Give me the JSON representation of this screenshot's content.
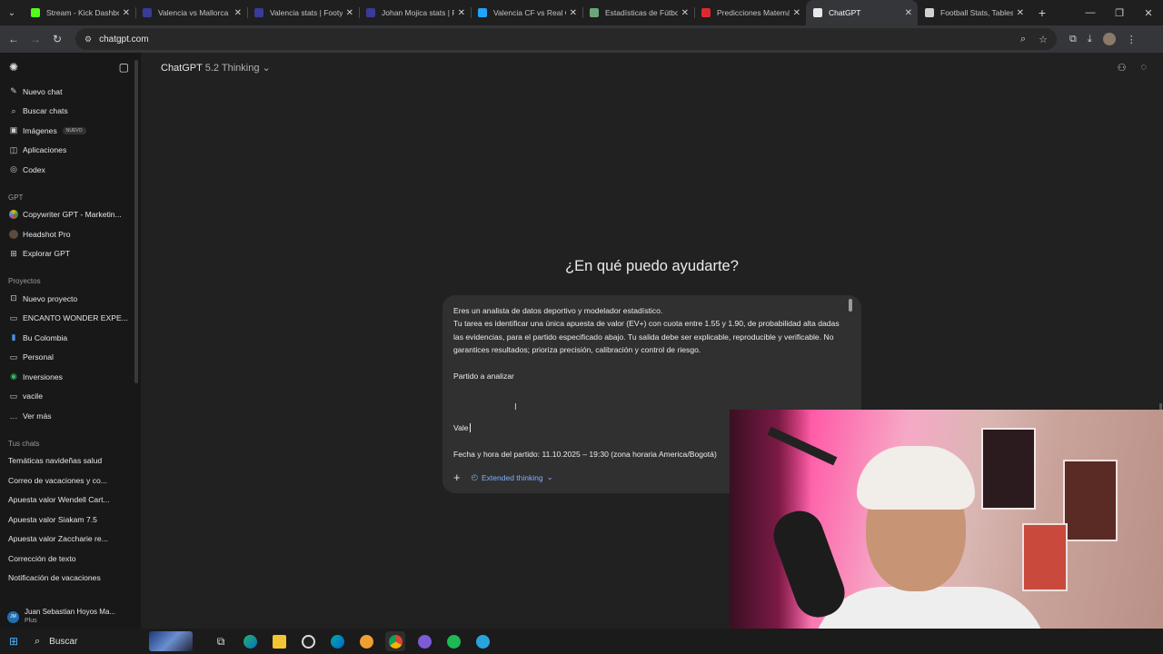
{
  "browser": {
    "tabs": [
      {
        "title": "Stream - Kick Dashbo",
        "color": "#53fc18"
      },
      {
        "title": "Valencia vs Mallorca",
        "color": "#3a3a9a"
      },
      {
        "title": "Valencia stats | Footy",
        "color": "#3a3a9a"
      },
      {
        "title": "Johan Mojica stats | F",
        "color": "#3a3a9a"
      },
      {
        "title": "Valencia CF vs Real C",
        "color": "#20a4ff"
      },
      {
        "title": "Estadísticas de Fútbo",
        "color": "#6aa67a"
      },
      {
        "title": "Predicciones Matemá",
        "color": "#e0282e"
      },
      {
        "title": "ChatGPT",
        "color": "#e8e8e8",
        "active": true
      },
      {
        "title": "Football Stats, Tables",
        "color": "#d0d0d0"
      }
    ],
    "url": "chatgpt.com"
  },
  "sidebar": {
    "main_items": [
      {
        "label": "Nuevo chat",
        "icon": "edit-icon"
      },
      {
        "label": "Buscar chats",
        "icon": "search-icon"
      },
      {
        "label": "Imágenes",
        "icon": "image-icon",
        "badge": "NUEVO"
      },
      {
        "label": "Aplicaciones",
        "icon": "apps-icon"
      },
      {
        "label": "Codex",
        "icon": "codex-icon"
      }
    ],
    "gpt_section": "GPT",
    "gpt_items": [
      {
        "label": "Copywriter GPT - Marketin...",
        "icon": "copywriter-gpt-icon"
      },
      {
        "label": "Headshot Pro",
        "icon": "headshot-pro-icon"
      },
      {
        "label": "Explorar GPT",
        "icon": "explore-icon"
      }
    ],
    "projects_section": "Proyectos",
    "project_items": [
      {
        "label": "Nuevo proyecto",
        "icon": "new-folder-icon"
      },
      {
        "label": "ENCANTO WONDER EXPE...",
        "icon": "folder-icon"
      },
      {
        "label": "Bu Colombia",
        "icon": "folder-icon"
      },
      {
        "label": "Personal",
        "icon": "folder-icon"
      },
      {
        "label": "Inversiones",
        "icon": "money-icon"
      },
      {
        "label": "vacile",
        "icon": "folder-icon"
      },
      {
        "label": "Ver más",
        "icon": "more-icon"
      }
    ],
    "chats_section": "Tus chats",
    "chats": [
      "Temáticas navideñas salud",
      "Correo de vacaciones y co...",
      "Apuesta valor Wendell Cart...",
      "Apuesta valor Siakam 7.5",
      "Apuesta valor Zaccharie re...",
      "Corrección de texto",
      "Notificación de vacaciones"
    ],
    "user": {
      "name": "Juan Sebastian Hoyos Ma...",
      "plan": "Plus",
      "initials": "JM"
    }
  },
  "main": {
    "model_name": "ChatGPT",
    "model_variant": "5.2 Thinking",
    "greeting": "¿En qué puedo ayudarte?",
    "prompt": {
      "line1": "Eres un analista de datos deportivo y modelador estadístico.",
      "line2": "Tu tarea es identificar una única apuesta de valor (EV+) con cuota entre 1.55 y 1.90, de probabilidad alta dadas las evidencias, para el partido especificado abajo. Tu salida debe ser explicable, reproducible y verificable. No garantices resultados; prioriza precisión, calibración y control de riesgo.",
      "line3": "Partido a analizar",
      "line4": "Vale",
      "line5": "Fecha y hora del partido: 11.10.2025 – 19:30 (zona horaria America/Bogotá)"
    },
    "extended_thinking": "Extended thinking"
  },
  "taskbar": {
    "search_placeholder": "Buscar"
  }
}
